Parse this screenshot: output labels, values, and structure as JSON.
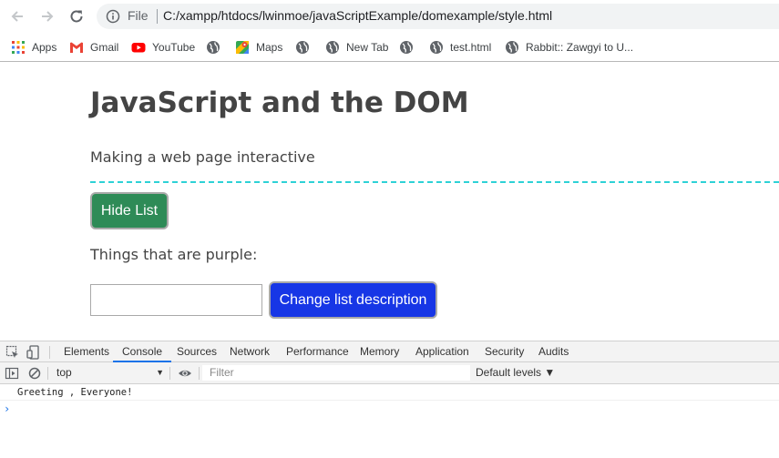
{
  "browser": {
    "nav": {
      "back_icon": "arrow-left-icon",
      "forward_icon": "arrow-right-icon",
      "reload_icon": "reload-icon"
    },
    "address": {
      "scheme_label": "File",
      "url": "C:/xampp/htdocs/lwinmoe/javaScriptExample/domexample/style.html"
    },
    "bookmarks": [
      {
        "label": "Apps",
        "icon": "apps-grid-icon"
      },
      {
        "label": "Gmail",
        "icon": "gmail-icon"
      },
      {
        "label": "YouTube",
        "icon": "youtube-icon"
      },
      {
        "label": "",
        "icon": "globe-icon"
      },
      {
        "label": "Maps",
        "icon": "maps-icon"
      },
      {
        "label": "",
        "icon": "globe-icon"
      },
      {
        "label": "New Tab",
        "icon": "globe-icon"
      },
      {
        "label": "",
        "icon": "globe-icon"
      },
      {
        "label": "test.html",
        "icon": "globe-icon"
      },
      {
        "label": "Rabbit:: Zawgyi to U...",
        "icon": "globe-icon"
      }
    ]
  },
  "page": {
    "title": "JavaScript and the DOM",
    "description": "Making a web page interactive",
    "hide_button": "Hide List",
    "list_heading": "Things that are purple:",
    "description_input": {
      "value": "",
      "placeholder": ""
    },
    "change_button": "Change list description",
    "colors": {
      "hide_button_bg": "#2e8b57",
      "change_button_bg": "#1736e6",
      "divider": "#2ed2d6"
    }
  },
  "devtools": {
    "tabs": [
      "Elements",
      "Console",
      "Sources",
      "Network",
      "Performance",
      "Memory",
      "Application",
      "Security",
      "Audits"
    ],
    "active_tab": "Console",
    "toolbar": {
      "context": "top",
      "filter_placeholder": "Filter",
      "levels": "Default levels ▼"
    },
    "console": {
      "messages": [
        "Greeting , Everyone!"
      ],
      "prompt": "›"
    }
  }
}
